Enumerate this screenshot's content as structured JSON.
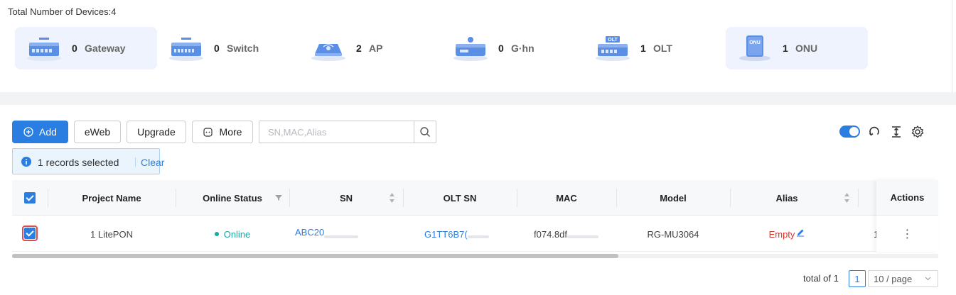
{
  "summary": {
    "total_label": "Total Number of Devices:4",
    "devices": [
      {
        "count": "0",
        "label": "Gateway",
        "icon": "gateway-icon"
      },
      {
        "count": "0",
        "label": "Switch",
        "icon": "switch-icon"
      },
      {
        "count": "2",
        "label": "AP",
        "icon": "ap-icon"
      },
      {
        "count": "0",
        "label": "G·hn",
        "icon": "ghn-icon"
      },
      {
        "count": "1",
        "label": "OLT",
        "icon": "olt-icon"
      },
      {
        "count": "1",
        "label": "ONU",
        "icon": "onu-icon"
      }
    ],
    "icon_texts": {
      "olt": "OLT",
      "onu": "ONU"
    }
  },
  "toolbar": {
    "add_label": "Add",
    "eweb_label": "eWeb",
    "upgrade_label": "Upgrade",
    "more_label": "More",
    "search_placeholder": "SN,MAC,Alias"
  },
  "selection": {
    "text": "1 records selected",
    "clear_label": "Clear"
  },
  "table": {
    "columns": [
      "Project Name",
      "Online Status",
      "SN",
      "OLT SN",
      "MAC",
      "Model",
      "Alias",
      "Actions"
    ],
    "rows": [
      {
        "project_name": "1 LitePON",
        "online_status": "Online",
        "sn": "ABC20",
        "olt_sn": "G1TT6B7(",
        "mac": "f074.8df",
        "model": "RG-MU3064",
        "alias": "Empty",
        "extra": "1",
        "actions": "⋮"
      }
    ]
  },
  "pagination": {
    "total_label": "total of 1",
    "current_page": "1",
    "page_size": "10 / page"
  },
  "colors": {
    "primary": "#2a7de1",
    "online": "#1aa7a0",
    "alias_empty": "#d9362e"
  }
}
